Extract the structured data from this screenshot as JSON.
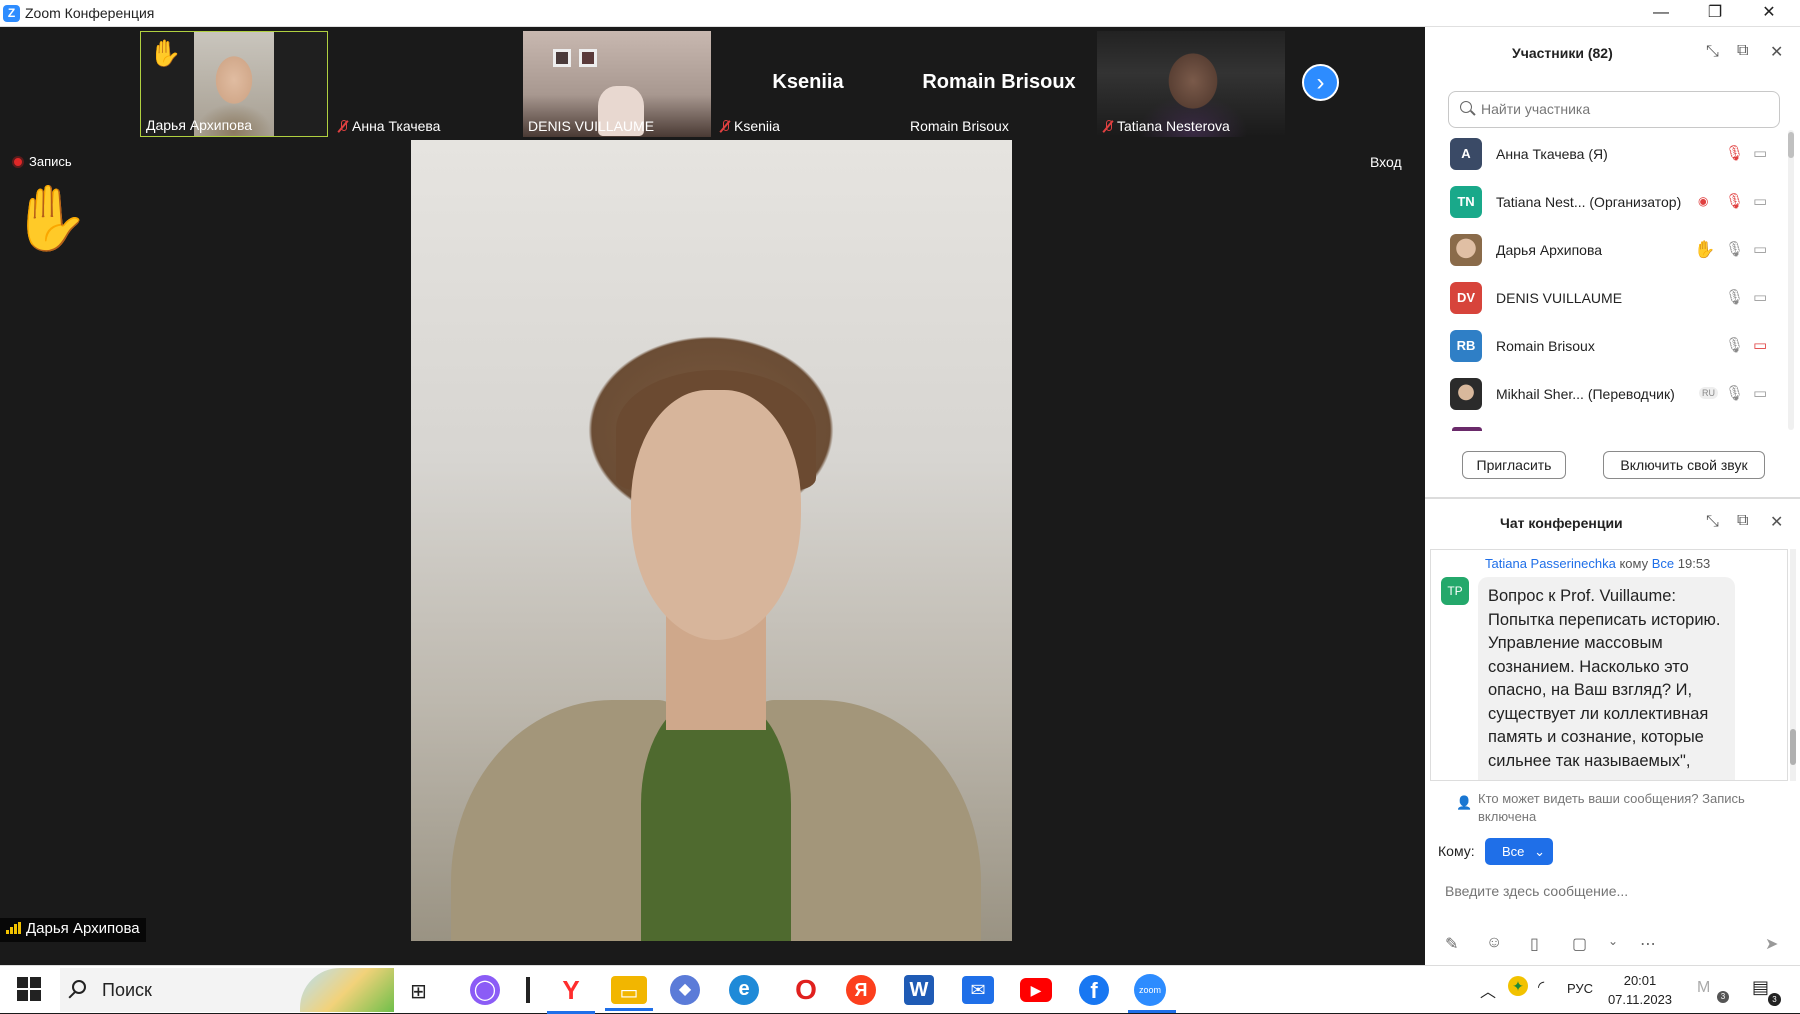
{
  "window": {
    "title": "Zoom Конференция",
    "logo_letter": "Z",
    "minimize": "—",
    "restore": "❐",
    "close": "✕"
  },
  "thumbnails": [
    {
      "name": "Дарья Архипова",
      "muted": false,
      "hand": true,
      "video": true
    },
    {
      "name": "Анна Ткачева",
      "muted": true,
      "hand": false,
      "video": false
    },
    {
      "name": "DENIS VUILLAUME",
      "muted": false,
      "hand": false,
      "video": true
    },
    {
      "name": "Kseniia",
      "big": "Kseniia",
      "muted": true,
      "hand": false,
      "video": false
    },
    {
      "name": "Romain Brisoux",
      "big": "Romain Brisoux",
      "muted": false,
      "hand": false,
      "video": false
    },
    {
      "name": "Tatiana Nesterova",
      "muted": true,
      "hand": false,
      "video": true
    }
  ],
  "stage": {
    "recording_label": "Запись",
    "raise_hand_icon": "✋",
    "enter_label": "Вход",
    "speaker_name": "Дарья Архипова",
    "next_page": "›"
  },
  "participants": {
    "title": "Участники (82)",
    "search_placeholder": "Найти участника",
    "rows": [
      {
        "initials": "A",
        "color": "#3a4a66",
        "name": "Анна Ткачева",
        "tag": "(Я)",
        "mic": "muted",
        "cam": "off"
      },
      {
        "initials": "TN",
        "color": "#19a98a",
        "name": "Tatiana Nest...",
        "tag": "(Организатор)",
        "rec": true,
        "mic": "muted",
        "cam": "off"
      },
      {
        "initials": "",
        "color": "#8a6b4a",
        "name": "Дарья Архипова",
        "tag": "",
        "hand": true,
        "mic": "on",
        "cam": "off"
      },
      {
        "initials": "DV",
        "color": "#d7443b",
        "name": "DENIS VUILLAUME",
        "tag": "",
        "mic": "on",
        "cam": "off"
      },
      {
        "initials": "RB",
        "color": "#2f7fc6",
        "name": "Romain Brisoux",
        "tag": "",
        "mic": "on",
        "cam": "off-red"
      },
      {
        "initials": "",
        "color": "#2b2b2b",
        "name": "Mikhail Sher...",
        "tag": "(Переводчик)",
        "lang": "RU",
        "mic": "on",
        "cam": "off"
      }
    ],
    "invite_label": "Пригласить",
    "unmute_label": "Включить свой звук"
  },
  "chat": {
    "title": "Чат конференции",
    "message": {
      "avatar": "TP",
      "sender": "Tatiana Passerinechka",
      "to_word": "кому",
      "to": "Все",
      "time": "19:53",
      "text": "Вопрос к Prof. Vuillaume: Попытка переписать историю. Управление массовым сознанием. Насколько это опасно, на Ваш взгляд? И, существует ли коллективная память и сознание, которые сильнее так называемых\", которые"
    },
    "visibility_note": "Кто может видеть ваши сообщения? Запись включена",
    "to_label": "Кому:",
    "to_value": "Все",
    "input_placeholder": "Введите здесь сообщение..."
  },
  "taskbar": {
    "search_label": "Поиск",
    "language": "РУС",
    "time": "20:01",
    "date": "07.11.2023",
    "notification_count": "3",
    "apps": [
      {
        "icon": "alice-icon",
        "glyph": "◯",
        "color": "#8b5cf6"
      },
      {
        "icon": "yandex-browser-icon",
        "glyph": "Y",
        "color": "#ff2d2d"
      },
      {
        "icon": "file-explorer-icon",
        "glyph": "▭",
        "color": "#f2b600"
      },
      {
        "icon": "copilot-icon",
        "glyph": "◆",
        "color": "#5b7bd8"
      },
      {
        "icon": "edge-icon",
        "glyph": "e",
        "color": "#1f8ad8"
      },
      {
        "icon": "opera-icon",
        "glyph": "O",
        "color": "#e0201e"
      },
      {
        "icon": "yandex-icon",
        "glyph": "Я",
        "color": "#fc3f1d"
      },
      {
        "icon": "word-icon",
        "glyph": "W",
        "color": "#1f5bb5"
      },
      {
        "icon": "mail-icon",
        "glyph": "✉",
        "color": "#1f6fe8"
      },
      {
        "icon": "youtube-icon",
        "glyph": "▶",
        "color": "#ff0000"
      },
      {
        "icon": "facebook-icon",
        "glyph": "f",
        "color": "#1877f2"
      },
      {
        "icon": "zoom-icon",
        "glyph": "zoom",
        "color": "#2d8cff"
      }
    ]
  }
}
